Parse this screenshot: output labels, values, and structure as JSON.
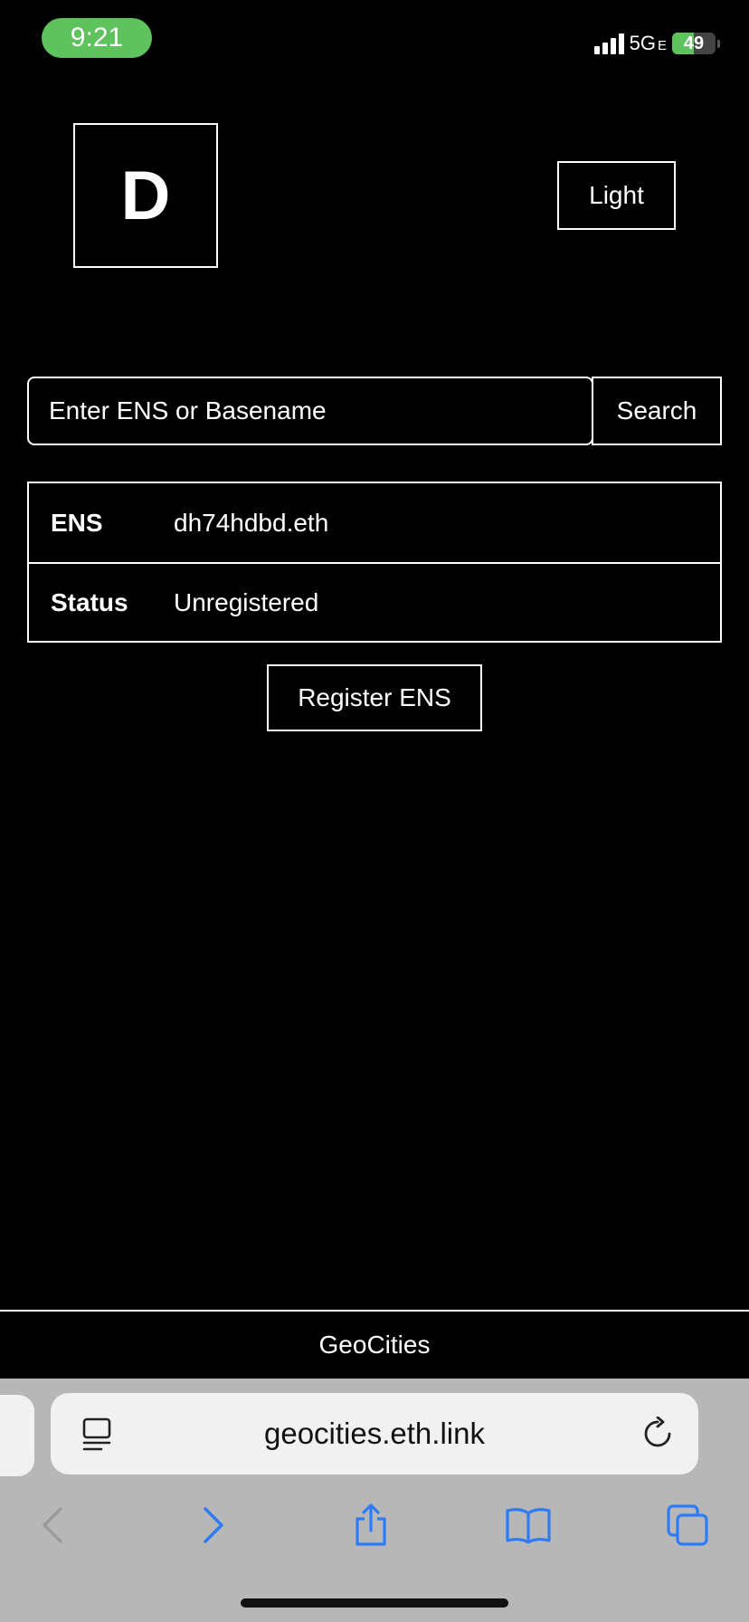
{
  "status_bar": {
    "time": "9:21",
    "network": "5G",
    "network_suffix": "E",
    "battery": "49",
    "battery_level": 0.49
  },
  "header": {
    "logo_letter": "D",
    "theme_button": "Light"
  },
  "search": {
    "placeholder": "Enter ENS or Basename",
    "button": "Search"
  },
  "info": {
    "rows": [
      {
        "key": "ENS",
        "value": "dh74hdbd.eth"
      },
      {
        "key": "Status",
        "value": "Unregistered"
      }
    ]
  },
  "actions": {
    "register": "Register ENS"
  },
  "footer": {
    "label": "GeoCities"
  },
  "browser": {
    "url": "geocities.eth.link",
    "icons": [
      "reader-icon",
      "reload-icon",
      "back-icon",
      "forward-icon",
      "share-icon",
      "bookmarks-icon",
      "tabs-icon"
    ],
    "accent": "#2f7bf5",
    "disabled": "#9a9a9a"
  },
  "colors": {
    "background": "#000000",
    "foreground": "#ffffff",
    "time_pill": "#5ec35c"
  }
}
